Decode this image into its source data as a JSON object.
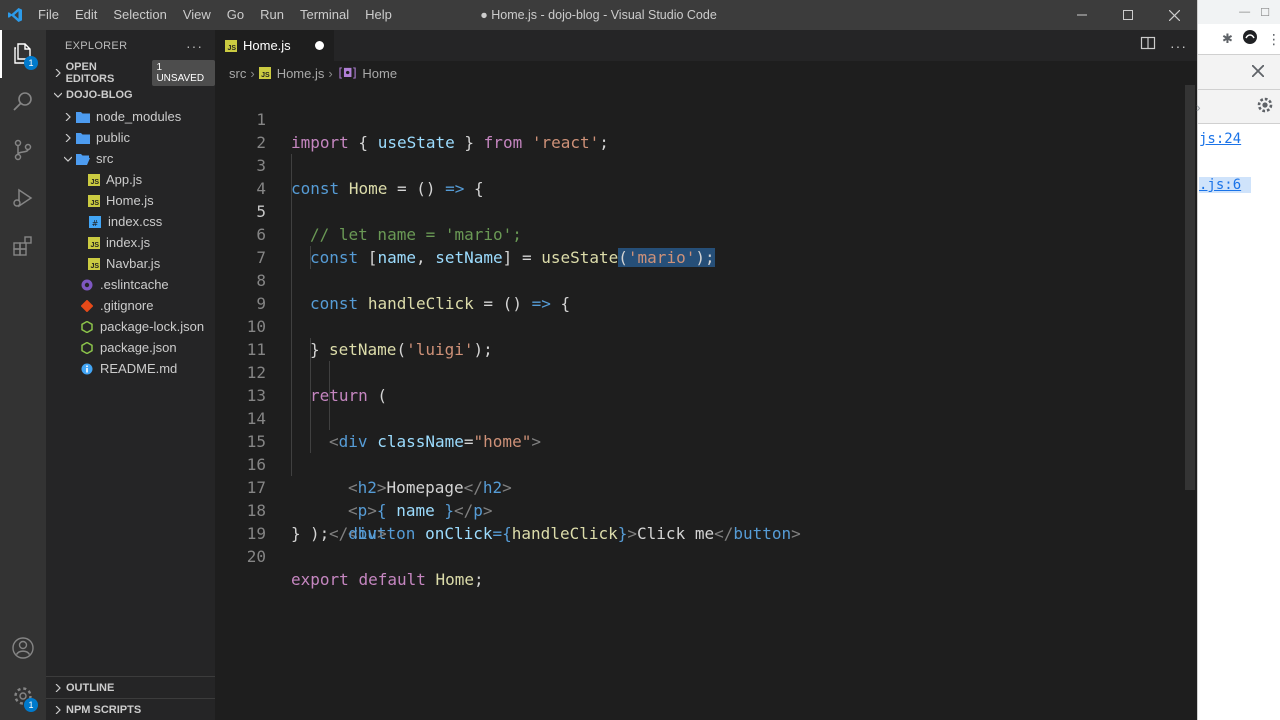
{
  "window": {
    "title": "● Home.js - dojo-blog - Visual Studio Code",
    "menu": [
      "File",
      "Edit",
      "Selection",
      "View",
      "Go",
      "Run",
      "Terminal",
      "Help"
    ]
  },
  "activity": {
    "explorer_badge": "1",
    "settings_badge": "1"
  },
  "sidebar": {
    "title": "EXPLORER",
    "open_editors": "OPEN EDITORS",
    "unsaved": "1 UNSAVED",
    "project": "DOJO-BLOG",
    "tree": {
      "node_modules": "node_modules",
      "public": "public",
      "src": "src",
      "app": "App.js",
      "home": "Home.js",
      "index_css": "index.css",
      "index_js": "index.js",
      "navbar": "Navbar.js",
      "eslintcache": ".eslintcache",
      "gitignore": ".gitignore",
      "package_lock": "package-lock.json",
      "package_json": "package.json",
      "readme": "README.md"
    },
    "outline": "OUTLINE",
    "npm_scripts": "NPM SCRIPTS"
  },
  "editor": {
    "tab_label": "Home.js",
    "breadcrumb": {
      "folder": "src",
      "file": "Home.js",
      "symbol": "Home"
    },
    "line_numbers": [
      "1",
      "2",
      "3",
      "4",
      "5",
      "6",
      "7",
      "8",
      "9",
      "10",
      "11",
      "12",
      "13",
      "14",
      "15",
      "16",
      "17",
      "18",
      "19",
      "20"
    ],
    "code": {
      "l1_import": "import",
      "l1_open": " { ",
      "l1_usestate": "useState",
      "l1_close": " } ",
      "l1_from": "from",
      "l1_sp": " ",
      "l1_react": "'react'",
      "l1_end": ";",
      "l3_const": "const",
      "l3_sp": " ",
      "l3_home": "Home",
      "l3_rest": " = () ",
      "l3_arrow": "=>",
      "l3_brace": " {",
      "l4_comment": "// let name = 'mario';",
      "l5_const": "const",
      "l5_open": " [",
      "l5_name": "name",
      "l5_comma": ", ",
      "l5_setname": "setName",
      "l5_eq": "] = ",
      "l5_usestate": "useState",
      "l5_paren": "(",
      "l5_mario": "'mario'",
      "l5_end": ");",
      "l7_const": "const",
      "l7_sp": " ",
      "l7_handle": "handleClick",
      "l7_rest": " = () ",
      "l7_arrow": "=>",
      "l7_brace": " {",
      "l8_setname": "setName",
      "l8_paren": "(",
      "l8_luigi": "'luigi'",
      "l8_end": ");",
      "l9_brace": "}",
      "l11_return": "return",
      "l11_paren": " (",
      "l12_lt": "<",
      "l12_div": "div",
      "l12_sp": " ",
      "l12_attr": "className",
      "l12_eq": "=",
      "l12_val": "\"home\"",
      "l12_gt": ">",
      "l13_open": "<",
      "l13_h2": "h2",
      "l13_gt": ">",
      "l13_text": "Homepage",
      "l13_close": "</",
      "l13_h2b": "h2",
      "l13_gt2": ">",
      "l14_open": "<",
      "l14_p": "p",
      "l14_gt": ">",
      "l14_lb": "{ ",
      "l14_name": "name",
      "l14_rb": " }",
      "l14_close": "</",
      "l14_pb": "p",
      "l14_gt2": ">",
      "l15_open": "<",
      "l15_button": "button",
      "l15_sp": " ",
      "l15_attr": "onClick",
      "l15_eq": "={",
      "l15_handler": "handleClick",
      "l15_rb": "}",
      "l15_gt": ">",
      "l15_text": "Click me",
      "l15_close": "</",
      "l15_buttonb": "button",
      "l15_gt2": ">",
      "l16_close": "</",
      "l16_div": "div",
      "l16_gt": ">",
      "l17_end": ");",
      "l18_brace": "}",
      "l20_export": "export",
      "l20_sp": " ",
      "l20_default": "default",
      "l20_sp2": " ",
      "l20_home": "Home",
      "l20_end": ";"
    }
  },
  "browser": {
    "link1": "js:24",
    "link2": ".js:6"
  },
  "colors": {
    "accent": "#007acc",
    "keyword": "#569cd6",
    "string": "#ce9178",
    "function": "#dcdcaa",
    "comment": "#6a9955",
    "variable": "#9cdcfe"
  }
}
